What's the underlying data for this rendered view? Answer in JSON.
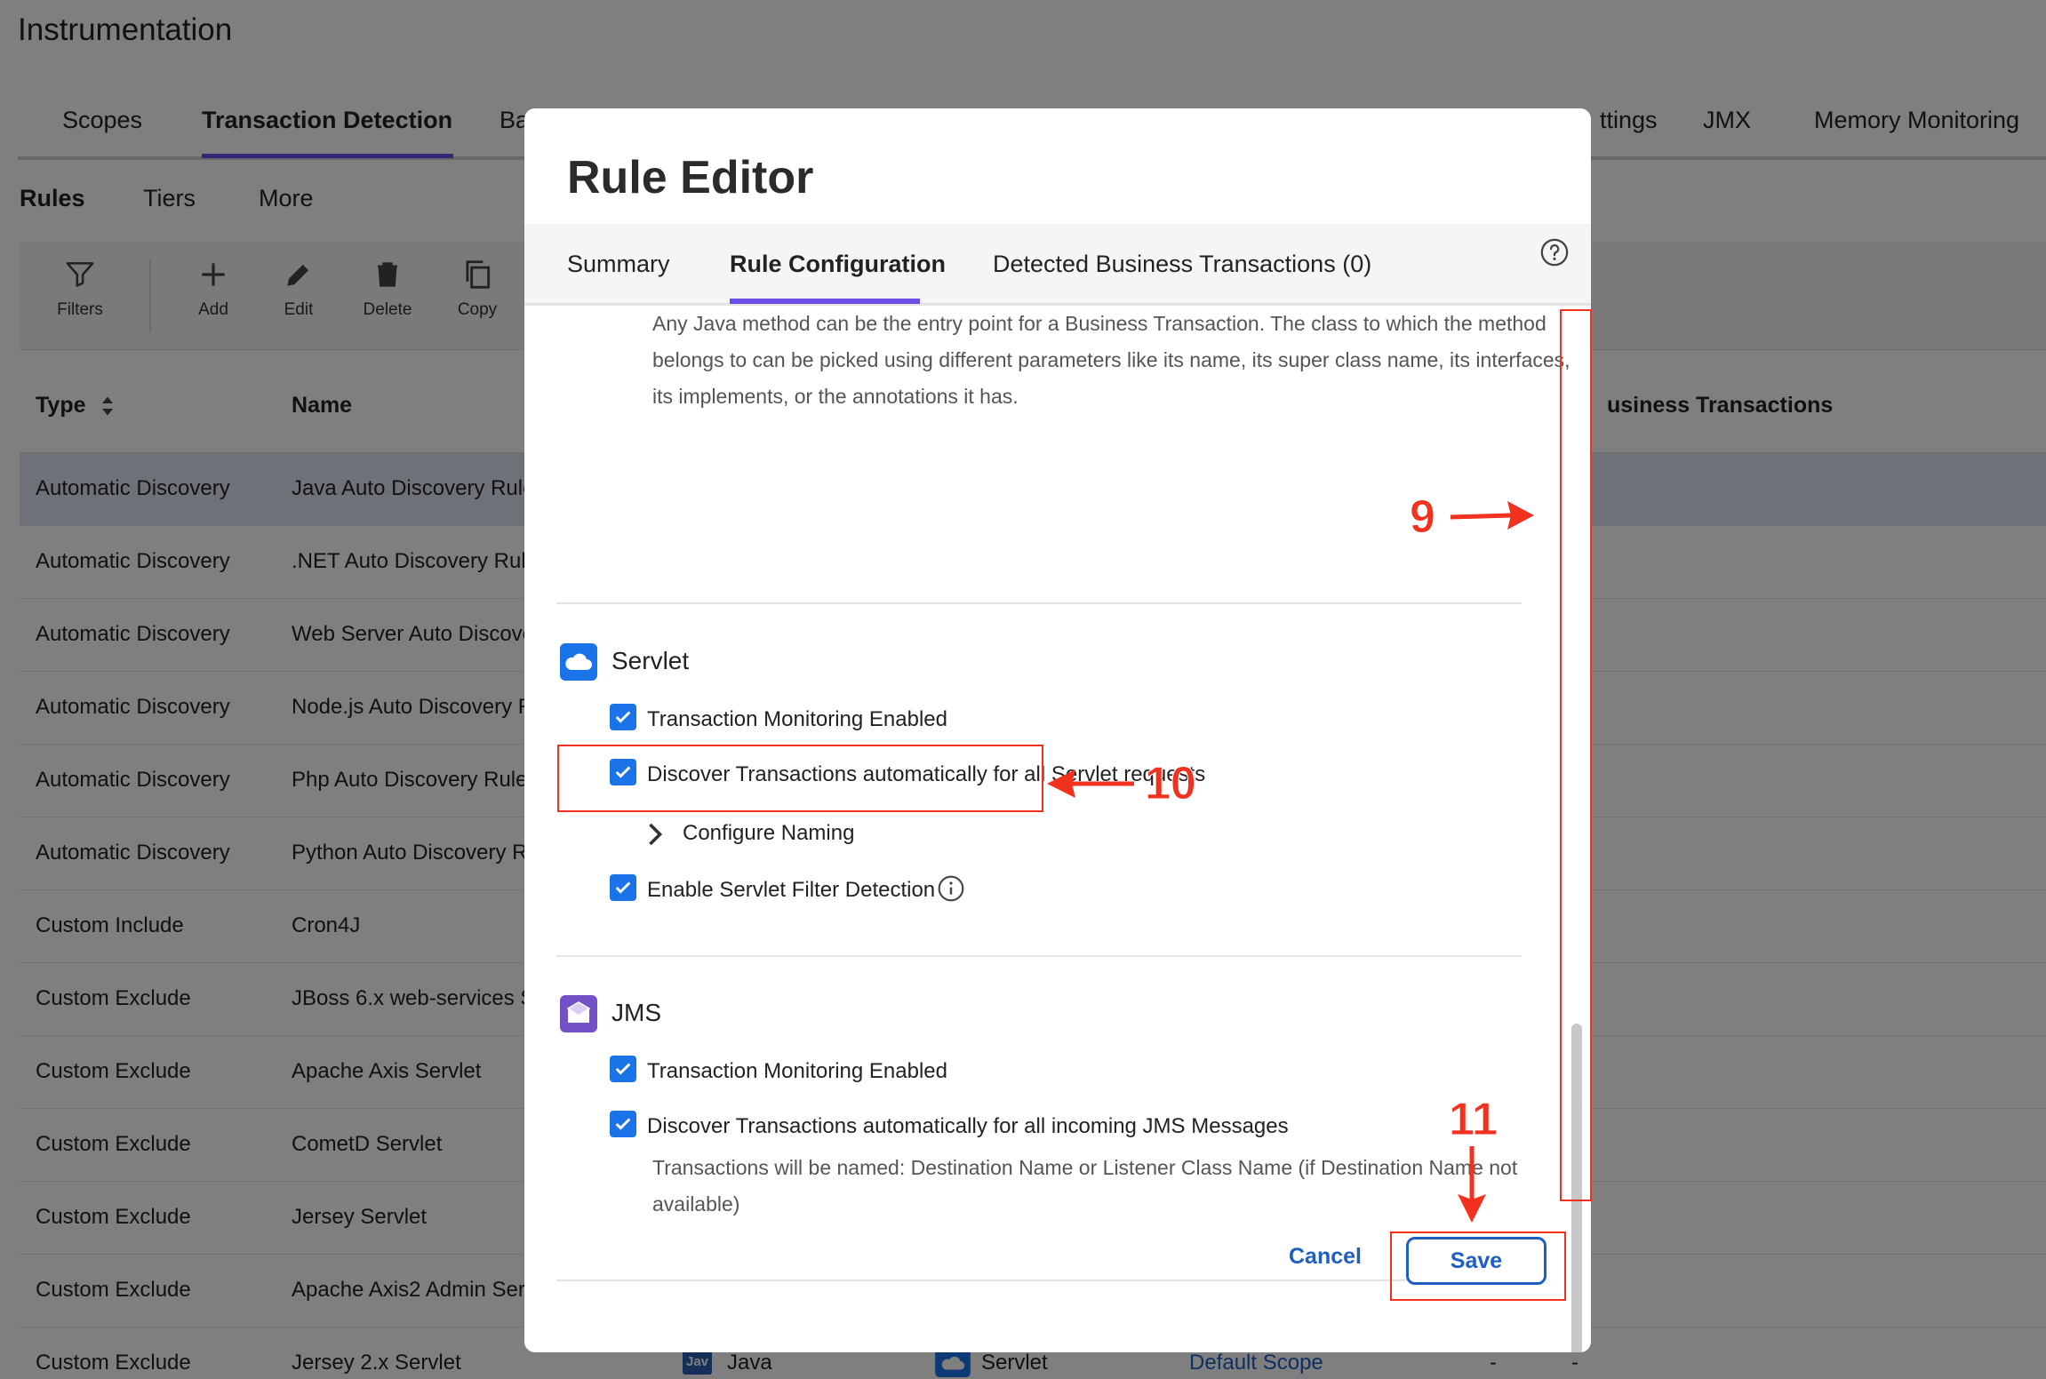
{
  "page": {
    "title": "Instrumentation",
    "tabs": [
      "Scopes",
      "Transaction Detection",
      "Ba",
      "ttings",
      "JMX",
      "Memory Monitoring"
    ],
    "sub_tabs": [
      "Rules",
      "Tiers",
      "More"
    ]
  },
  "toolbar": {
    "filters": "Filters",
    "add": "Add",
    "edit": "Edit",
    "delete": "Delete",
    "copy": "Copy"
  },
  "table": {
    "headers": {
      "type": "Type",
      "name": "Name",
      "business_transactions": "usiness Transactions"
    },
    "rows": [
      {
        "type": "Automatic Discovery",
        "name": "Java Auto Discovery Rule"
      },
      {
        "type": "Automatic Discovery",
        "name": ".NET Auto Discovery Rule"
      },
      {
        "type": "Automatic Discovery",
        "name": "Web Server Auto Discove"
      },
      {
        "type": "Automatic Discovery",
        "name": "Node.js Auto Discovery R"
      },
      {
        "type": "Automatic Discovery",
        "name": "Php Auto Discovery Rule"
      },
      {
        "type": "Automatic Discovery",
        "name": "Python Auto Discovery R"
      },
      {
        "type": "Custom Include",
        "name": "Cron4J"
      },
      {
        "type": "Custom Exclude",
        "name": "JBoss 6.x web-services S"
      },
      {
        "type": "Custom Exclude",
        "name": "Apache Axis Servlet"
      },
      {
        "type": "Custom Exclude",
        "name": "CometD Servlet"
      },
      {
        "type": "Custom Exclude",
        "name": "Jersey Servlet"
      },
      {
        "type": "Custom Exclude",
        "name": "Apache Axis2 Admin Ser"
      },
      {
        "type": "Custom Exclude",
        "name": "Jersey 2.x Servlet",
        "agent_badge": "Jav",
        "agent": "Java",
        "entry_point": "Servlet",
        "scope": "Default Scope",
        "col_a": "-",
        "col_b": "-"
      }
    ]
  },
  "modal": {
    "title": "Rule Editor",
    "tabs": [
      "Summary",
      "Rule Configuration",
      "Detected Business Transactions (0)"
    ],
    "intro": "Any Java method can be the entry point for a Business Transaction. The class to which the method belongs to can be picked using different parameters like its name, its super class name, its interfaces, its implements, or the annotations it has.",
    "servlet": {
      "title": "Servlet",
      "monitoring": "Transaction Monitoring Enabled",
      "discover": "Discover Transactions automatically for all Servlet requests",
      "configure_naming": "Configure Naming",
      "filter_detection": "Enable Servlet Filter Detection"
    },
    "jms": {
      "title": "JMS",
      "monitoring": "Transaction Monitoring Enabled",
      "discover": "Discover Transactions automatically for all incoming JMS Messages",
      "naming_note": "Transactions will be named: Destination Name or Listener Class Name (if Destination Name not available)"
    },
    "cancel": "Cancel",
    "save": "Save"
  },
  "annotations": [
    "9",
    "10",
    "11"
  ],
  "colors": {
    "accent": "#6b4ee6",
    "link": "#1f5fc1",
    "checkbox": "#1a73e8",
    "annotation": "#f2311f"
  }
}
